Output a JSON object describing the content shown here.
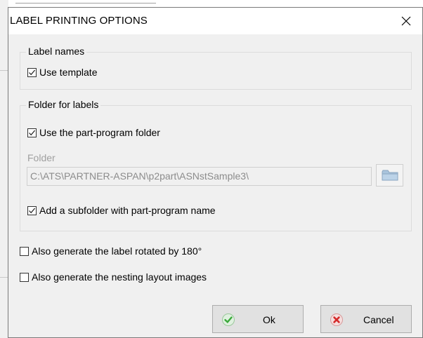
{
  "dialog": {
    "title": "LABEL PRINTING OPTIONS"
  },
  "label_names": {
    "legend": "Label names",
    "use_template": {
      "label": "Use template",
      "checked": true
    }
  },
  "folder_for_labels": {
    "legend": "Folder for labels",
    "use_part_program_folder": {
      "label": "Use the part-program folder",
      "checked": true
    },
    "folder_label": "Folder",
    "folder_value": "C:\\ATS\\PARTNER-ASPAN\\p2part\\ASNstSample3\\",
    "add_subfolder": {
      "label": "Add a subfolder with part-program name",
      "checked": true
    }
  },
  "options": {
    "rotated_180": {
      "label": "Also generate the label rotated by 180°",
      "checked": false
    },
    "nesting_images": {
      "label": "Also generate the nesting layout images",
      "checked": false
    }
  },
  "buttons": {
    "ok_label": "Ok",
    "cancel_label": "Cancel"
  },
  "icons": {
    "ok": "green-check-icon",
    "cancel": "red-x-icon",
    "browse": "folder-icon",
    "close": "close-icon"
  },
  "colors": {
    "dialog_bg": "#f0f0f0",
    "titlebar_bg": "#ffffff",
    "ok_green": "#3aa83a",
    "cancel_red": "#d42a2a"
  }
}
